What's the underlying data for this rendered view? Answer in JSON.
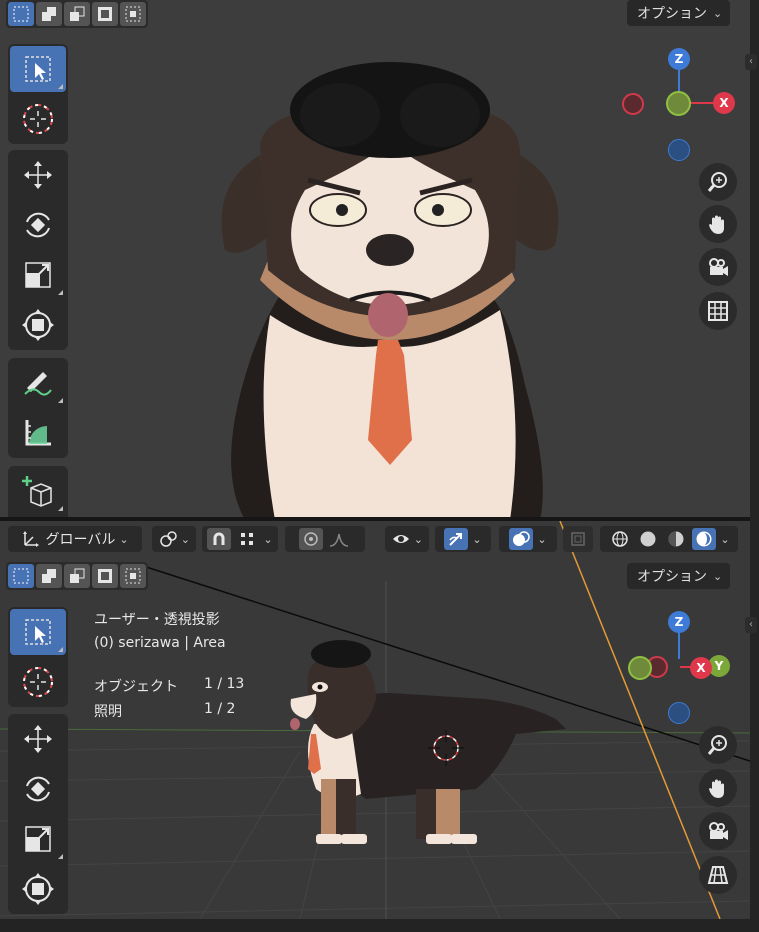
{
  "options_label": "オプション",
  "header": {
    "orientation_label": "グローバル"
  },
  "overlay_info": {
    "view_label": "ユーザー・透視投影",
    "object_line": "(0) serizawa | Area",
    "stats": [
      {
        "label": "オブジェクト",
        "value": "1 / 13"
      },
      {
        "label": "照明",
        "value": "1 / 2"
      }
    ]
  },
  "gizmo": {
    "x_label": "X",
    "y_label": "Y",
    "z_label": "Z",
    "colors": {
      "x": "#e0384b",
      "y": "#7ca83a",
      "z": "#3e7bd6"
    }
  },
  "colors": {
    "accent": "#4772b3",
    "viewport_bg": "#3d3d3d",
    "panel_bg": "#2a2a2a"
  },
  "icons": {
    "tools": [
      "select-box-icon",
      "cursor-icon",
      "move-icon",
      "rotate-icon",
      "scale-icon",
      "transform-icon",
      "annotate-icon",
      "measure-icon",
      "add-cube-icon"
    ],
    "nav": [
      "zoom-icon",
      "pan-hand-icon",
      "camera-icon",
      "grid-icon"
    ]
  }
}
